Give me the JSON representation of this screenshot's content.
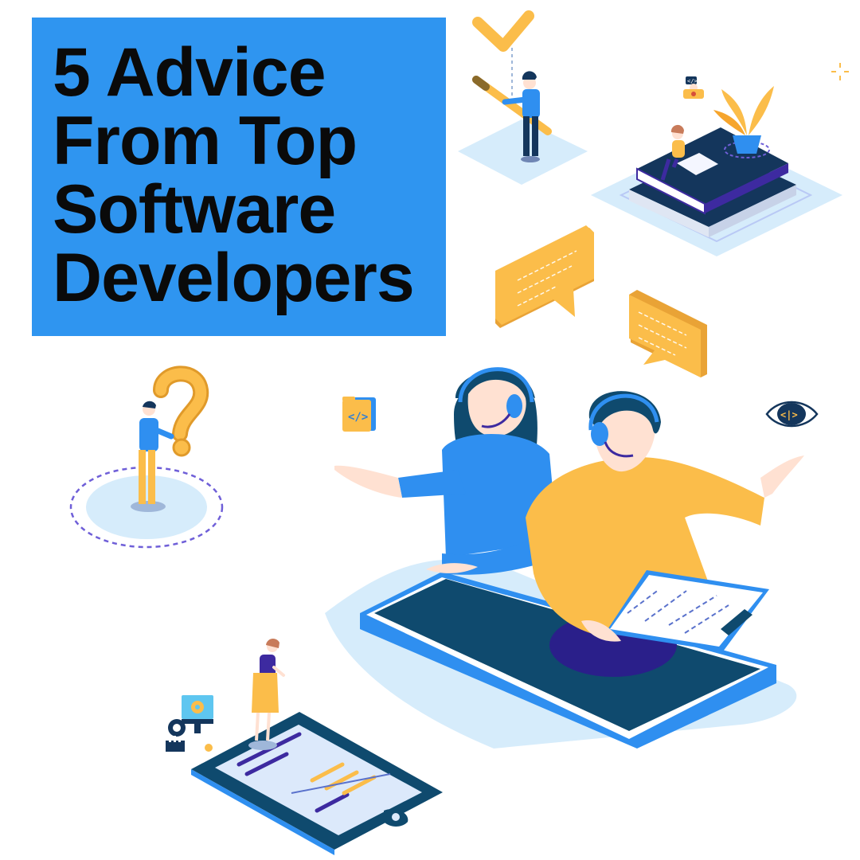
{
  "title": {
    "lines": [
      "5 Advice",
      "From Top",
      "Software",
      "Developers"
    ]
  },
  "colors": {
    "title_bg": "#2f95f0",
    "title_text": "#0a0a0a",
    "navy": "#0f4a6e",
    "blue": "#2f8ff0",
    "yellow": "#fbbd4a",
    "light_blue": "#d6ecfb",
    "purple": "#3d2aa0"
  },
  "icons": [
    "checkmark-icon",
    "robot-icon",
    "sparkle-icon",
    "chat-bubble-icon",
    "question-mark-icon",
    "code-folder-icon",
    "code-eye-icon",
    "headset-icon",
    "gear-monitor-icon",
    "clipboard-icon"
  ]
}
